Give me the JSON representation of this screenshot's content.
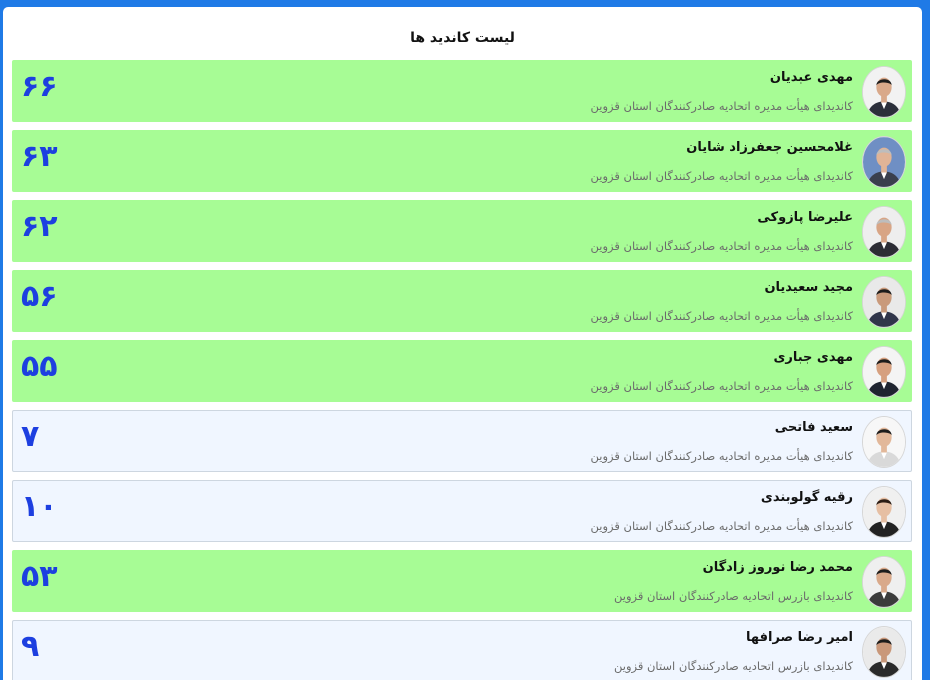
{
  "panel": {
    "title": "لیست کاندید ها"
  },
  "colors": {
    "elected_bg": "#a7fc95",
    "normal_bg": "#f0f6ff",
    "votes_color": "#1d3fe0",
    "outer_bg": "#1f7ae6"
  },
  "candidates": [
    {
      "name": "مهدی عبدیان",
      "role": "کاندیدای هیأت مدیره اتحادیه صادرکنندگان استان قزوین",
      "votes": "۶۶",
      "elected": true,
      "avatar": "person-photo-icon"
    },
    {
      "name": "غلامحسین جعفرزاد شایان",
      "role": "کاندیدای هیأت مدیره اتحادیه صادرکنندگان استان قزوین",
      "votes": "۶۳",
      "elected": true,
      "avatar": "person-photo-icon"
    },
    {
      "name": "علیرضا پازوکی",
      "role": "کاندیدای هیأت مدیره اتحادیه صادرکنندگان استان قزوین",
      "votes": "۶۲",
      "elected": true,
      "avatar": "person-photo-icon"
    },
    {
      "name": "مجید سعیدیان",
      "role": "کاندیدای هیأت مدیره اتحادیه صادرکنندگان استان قزوین",
      "votes": "۵۶",
      "elected": true,
      "avatar": "person-photo-icon"
    },
    {
      "name": "مهدی جباری",
      "role": "کاندیدای هیأت مدیره اتحادیه صادرکنندگان استان قزوین",
      "votes": "۵۵",
      "elected": true,
      "avatar": "person-photo-icon"
    },
    {
      "name": "سعید فاتحی",
      "role": "کاندیدای هیأت مدیره اتحادیه صادرکنندگان استان قزوین",
      "votes": "۷",
      "elected": false,
      "avatar": "person-photo-icon"
    },
    {
      "name": "رقیه گولوبندی",
      "role": "کاندیدای هیأت مدیره اتحادیه صادرکنندگان استان قزوین",
      "votes": "۱۰",
      "elected": false,
      "avatar": "person-photo-icon"
    },
    {
      "name": "محمد رضا نوروز زادگان",
      "role": "کاندیدای بازرس اتحادیه صادرکنندگان استان قزوین",
      "votes": "۵۳",
      "elected": true,
      "avatar": "person-photo-icon"
    },
    {
      "name": "امیر رضا صرافها",
      "role": "کاندیدای بازرس اتحادیه صادرکنندگان استان قزوین",
      "votes": "۹",
      "elected": false,
      "avatar": "person-photo-icon"
    }
  ]
}
